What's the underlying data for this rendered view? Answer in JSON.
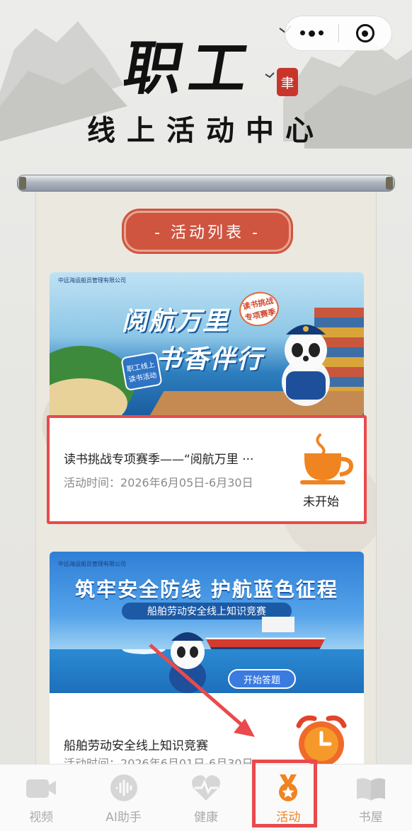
{
  "header": {
    "title_big": "职工",
    "seal": "聿",
    "subtitle": "线上活动中心"
  },
  "section": {
    "title": "- 活动列表 -"
  },
  "activities": [
    {
      "banner_logo": "中远海运船员管理有限公司",
      "banner_title_line1": "阅航万里",
      "banner_title_line2": "书香伴行",
      "banner_tag_line1": "读书挑战",
      "banner_tag_line2": "专项赛季",
      "banner_badge_line1": "职工线上",
      "banner_badge_line2": "读书活动",
      "title": "读书挑战专项赛季——“阅航万里 ···",
      "time_label": "活动时间：",
      "time_value": "2026年6月05日-6月30日",
      "status": "未开始",
      "status_icon": "coffee-cup-icon",
      "status_color": "#f08421"
    },
    {
      "banner_logo": "中远海运船员管理有限公司",
      "banner_title": "筑牢安全防线  护航蓝色征程",
      "banner_subtitle": "船舶劳动安全线上知识竞赛",
      "banner_button": "开始答题",
      "title": "船舶劳动安全线上知识竞赛",
      "time_label": "活动时间：",
      "time_value": "2026年6月01日-6月30日",
      "status_icon": "alarm-clock-icon"
    }
  ],
  "tabbar": {
    "items": [
      {
        "label": "视频",
        "icon": "video-camera-icon"
      },
      {
        "label": "AI助手",
        "icon": "voice-wave-icon"
      },
      {
        "label": "健康",
        "icon": "heart-pulse-icon"
      },
      {
        "label": "活动",
        "icon": "medal-icon",
        "active": true
      },
      {
        "label": "书屋",
        "icon": "open-book-icon"
      }
    ],
    "active_color": "#f08421",
    "inactive_color": "#aaaaaa"
  },
  "colors": {
    "accent_red": "#cf5540",
    "highlight_red": "#e94a4c"
  }
}
